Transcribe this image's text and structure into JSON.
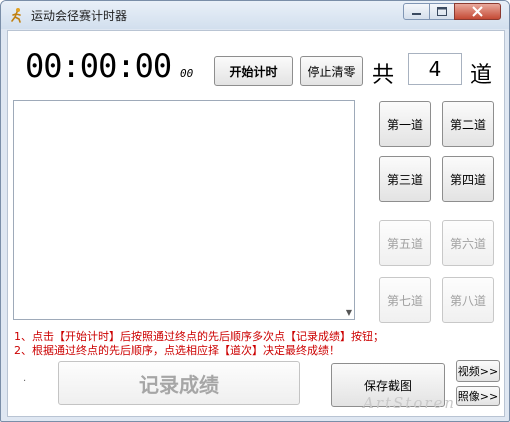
{
  "window": {
    "title": "运动会径赛计时器"
  },
  "timer": {
    "main": "00:00:00",
    "fraction": "00"
  },
  "toolbar": {
    "start_label": "开始计时",
    "stop_label": "停止清零"
  },
  "lanes": {
    "prefix": "共",
    "count": "4",
    "suffix": "道",
    "buttons": [
      {
        "label": "第一道",
        "enabled": true
      },
      {
        "label": "第二道",
        "enabled": true
      },
      {
        "label": "第三道",
        "enabled": true
      },
      {
        "label": "第四道",
        "enabled": true
      },
      {
        "label": "第五道",
        "enabled": false
      },
      {
        "label": "第六道",
        "enabled": false
      },
      {
        "label": "第七道",
        "enabled": false
      },
      {
        "label": "第八道",
        "enabled": false
      }
    ]
  },
  "hints": [
    "1、点击【开始计时】后按照通过终点的先后顺序多次点【记录成绩】按钮；",
    "2、根据通过终点的先后顺序，点选相应择【道次】决定最终成绩！"
  ],
  "actions": {
    "record_label": "记录成绩",
    "save_label": "保存截图",
    "video_label": "视频>>",
    "photo_label": "照像>>"
  },
  "watermark": "ArtStoren"
}
